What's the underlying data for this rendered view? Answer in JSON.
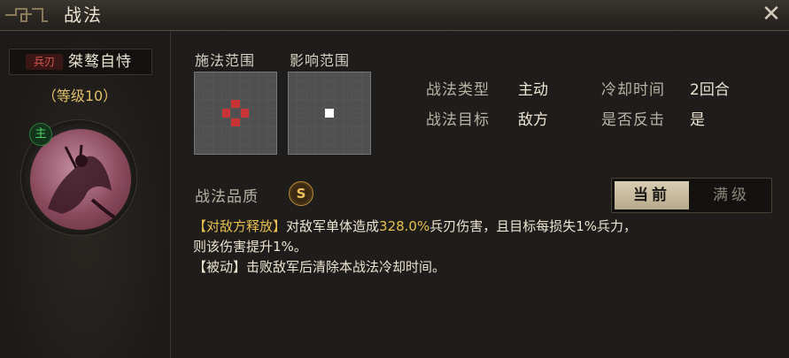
{
  "window": {
    "title": "战法",
    "close_icon": "close-icon"
  },
  "skill": {
    "weapon_tag": "兵刃",
    "name": "桀骜自恃",
    "level": "（等级10）",
    "role_badge": "主"
  },
  "ranges": {
    "cast_label": "施法范围",
    "effect_label": "影响范围",
    "cast_grid": {
      "size": 9,
      "marked": [
        [
          3,
          4
        ],
        [
          4,
          3
        ],
        [
          4,
          5
        ],
        [
          5,
          4
        ]
      ],
      "mark_color": "#c83434"
    },
    "effect_grid": {
      "size": 9,
      "marked": [
        [
          4,
          4
        ]
      ],
      "mark_color": "#ffffff"
    }
  },
  "info": {
    "type_label": "战法类型",
    "type_value": "主动",
    "cooldown_label": "冷却时间",
    "cooldown_value": "2回合",
    "target_label": "战法目标",
    "target_value": "敌方",
    "counter_label": "是否反击",
    "counter_value": "是"
  },
  "quality": {
    "label": "战法品质",
    "grade": "S"
  },
  "tabs": {
    "current": "当前",
    "max": "满级"
  },
  "description": {
    "line1_tag": "【对敌方释放】",
    "line1_pre": "对敌军单体造成",
    "line1_num": "328.0%",
    "line1_post": "兵刃伤害，且目标每损失1%兵力，",
    "line2": "则该伤害提升1%。",
    "line3_tag": "【被动】",
    "line3_text": "击败敌军后清除本战法冷却时间。"
  },
  "colors": {
    "accent_gold": "#e6c04e",
    "weapon_red": "#d85a4e",
    "title_text": "#ece4d2"
  }
}
